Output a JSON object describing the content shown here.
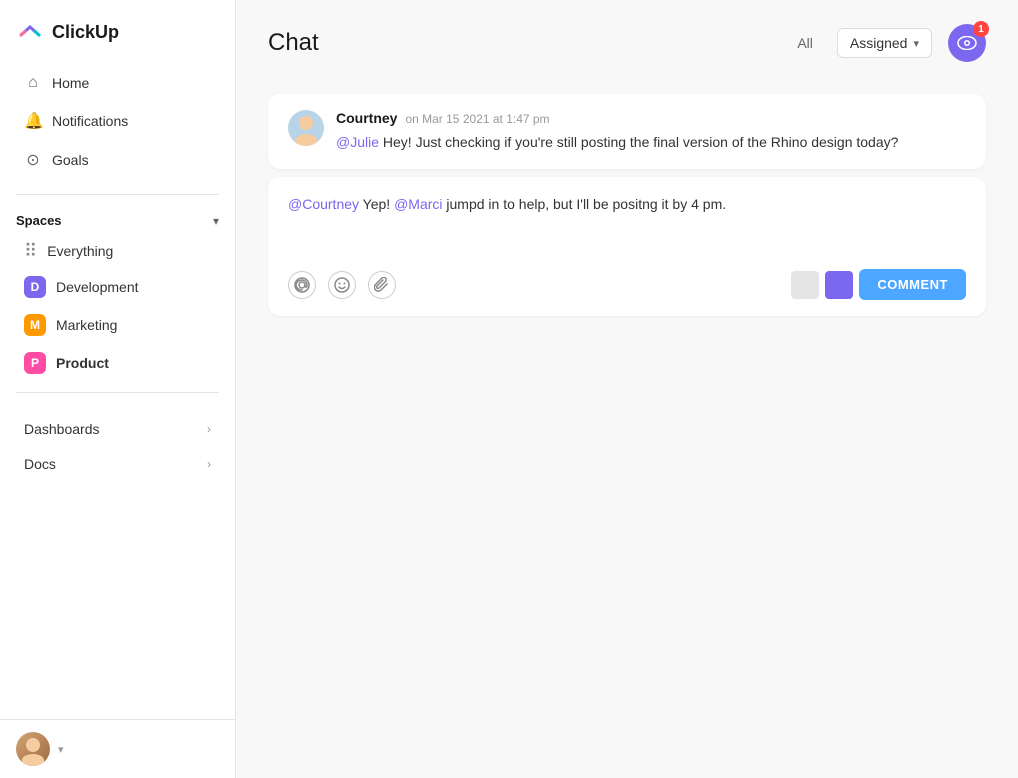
{
  "sidebar": {
    "logo_text": "ClickUp",
    "nav_items": [
      {
        "label": "Home",
        "icon": "🏠"
      },
      {
        "label": "Notifications",
        "icon": "🔔"
      },
      {
        "label": "Goals",
        "icon": "🏆"
      }
    ],
    "spaces_title": "Spaces",
    "space_items": [
      {
        "label": "Everything",
        "type": "dots"
      },
      {
        "label": "Development",
        "badge": "D",
        "color": "purple"
      },
      {
        "label": "Marketing",
        "badge": "M",
        "color": "orange"
      },
      {
        "label": "Product",
        "badge": "P",
        "color": "pink",
        "bold": true
      }
    ],
    "bottom_nav": [
      {
        "label": "Dashboards"
      },
      {
        "label": "Docs"
      }
    ]
  },
  "header": {
    "title": "Chat",
    "filter_all": "All",
    "filter_assigned": "Assigned",
    "watch_count": "1"
  },
  "message": {
    "author": "Courtney",
    "time": "on Mar 15 2021 at 1:47 pm",
    "mention": "@Julie",
    "text": " Hey! Just checking if you're still posting the final version of the Rhino design today?"
  },
  "reply": {
    "mention1": "@Courtney",
    "text1": " Yep! ",
    "mention2": "@Marci",
    "text2": " jumpd in to help, but I'll be positng it by 4 pm."
  },
  "toolbar": {
    "comment_label": "COMMENT"
  }
}
